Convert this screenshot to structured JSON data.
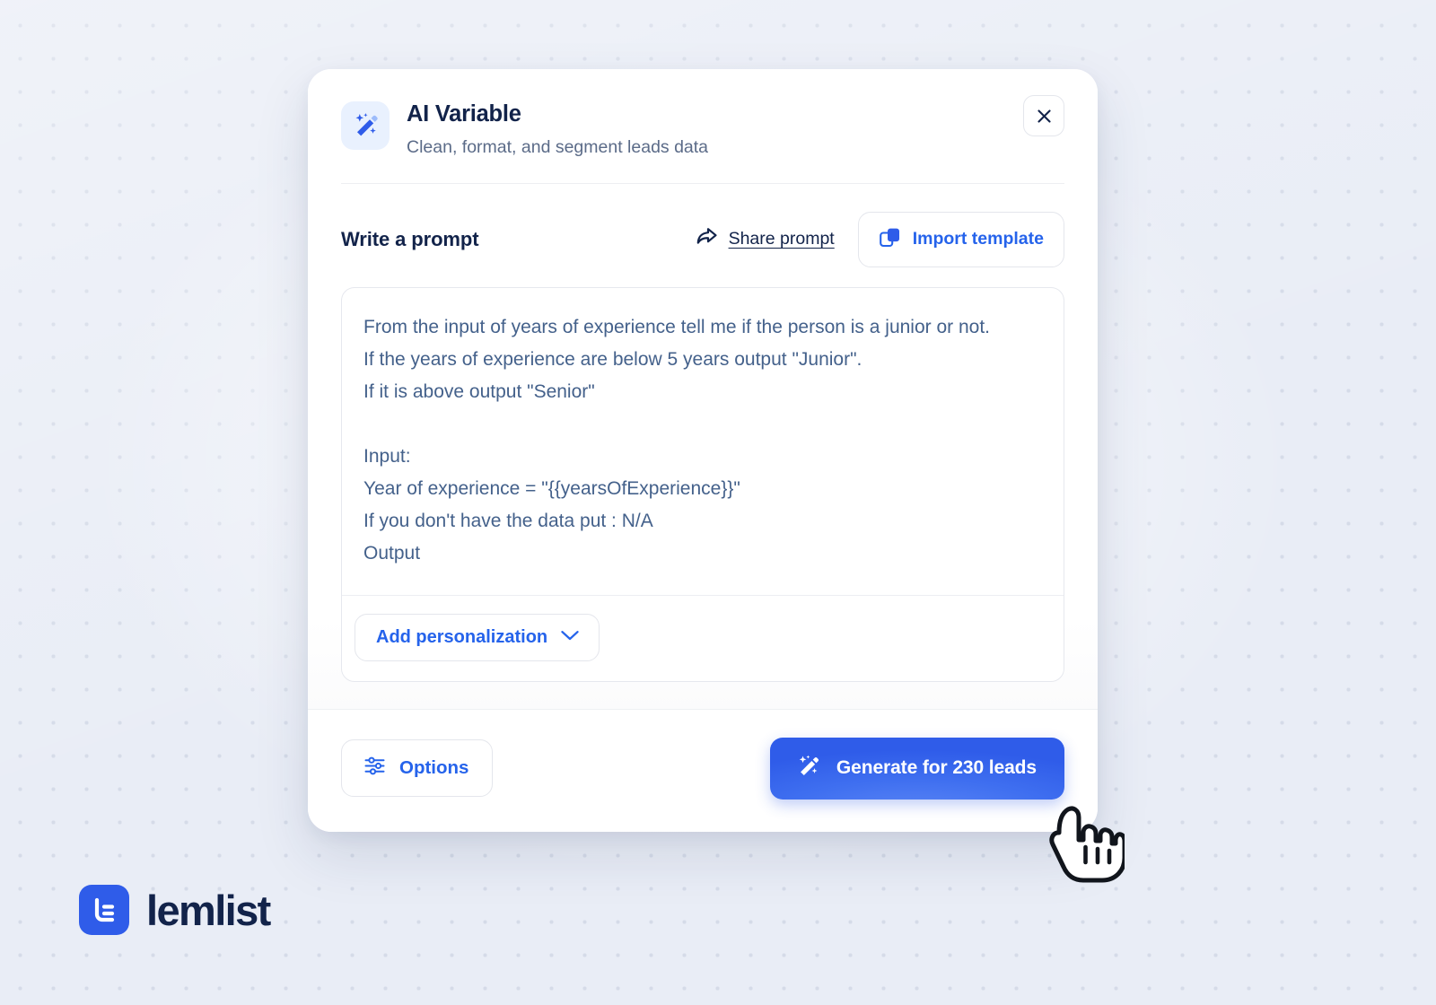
{
  "dialog": {
    "icon": "magic-wand-icon",
    "title": "AI Variable",
    "subtitle": "Clean, format, and segment leads data",
    "close_label": "✕"
  },
  "prompt_section": {
    "label": "Write a prompt",
    "share_prompt_label": "Share prompt",
    "share_icon": "share-arrow-icon",
    "import_template_label": "Import template",
    "import_icon": "copy-icon",
    "prompt_value": "From the input of years of experience tell me if the person is a junior or not.\nIf the years of experience are below 5 years output \"Junior\".\nIf it is above output \"Senior\"\n\nInput:\nYear of experience = \"{{yearsOfExperience}}\"\nIf you don't have the data put : N/A\nOutput",
    "add_personalization_label": "Add personalization",
    "chevron_icon": "chevron-down-icon"
  },
  "footer": {
    "options_label": "Options",
    "options_icon": "sliders-icon",
    "generate_label": "Generate for 230 leads",
    "generate_icon": "magic-wand-icon",
    "lead_count": 230
  },
  "brand": {
    "name": "lemlist",
    "mark": "lemlist-logo-icon"
  },
  "colors": {
    "accent_blue": "#2563eb",
    "button_blue": "#2f5ce9",
    "title_navy": "#12234a",
    "prompt_text": "#44618b",
    "subtitle": "#5b6b88",
    "background": "#e9edf6",
    "dot": "#d5dbe8"
  }
}
